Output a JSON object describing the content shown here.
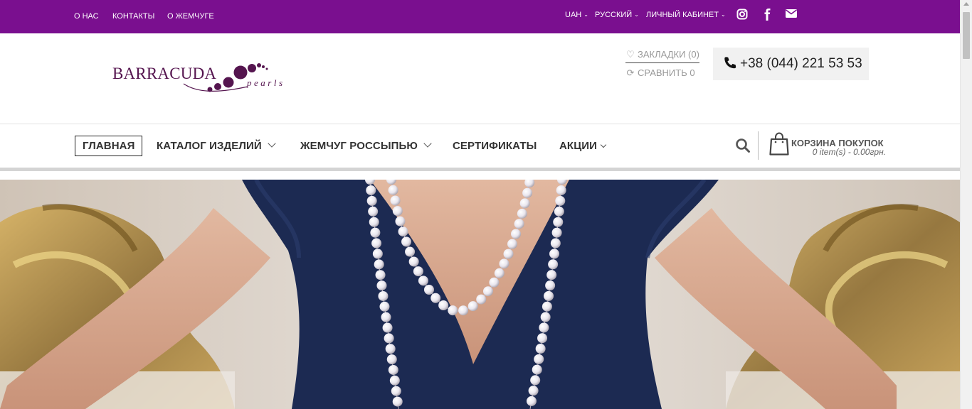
{
  "topbar": {
    "links": [
      "О НАС",
      "КОНТАКТЫ",
      "О ЖЕМЧУГЕ"
    ],
    "currency": "UAH",
    "language": "РУССКИЙ",
    "account": "ЛИЧНЫЙ КАБИНЕТ",
    "socials": [
      "instagram-icon",
      "facebook-icon",
      "envelope-icon"
    ],
    "bg_color": "#7a0f8f"
  },
  "header": {
    "logo_brand": "BARRACUDA",
    "logo_sub": "pearls",
    "wishlist": "ЗАКЛАДКИ (0)",
    "compare": "СРАВНИТЬ 0",
    "phone": "+38 (044) 221 53 53"
  },
  "nav": {
    "items": [
      {
        "label": "ГЛАВНАЯ",
        "active": true
      },
      {
        "label": "КАТАЛОГ ИЗДЕЛИЙ",
        "dropdown": true
      },
      {
        "label": "ЖЕМЧУГ РОССЫПЬЮ",
        "dropdown": true
      },
      {
        "label": "СЕРТИФИКАТЫ"
      },
      {
        "label": "АКЦИИ",
        "dropdown": true
      }
    ]
  },
  "cart": {
    "title": "КОРЗИНА ПОКУПОК",
    "summary": "0 item(s) - 0.00грн."
  },
  "hero": {
    "icon": "hero-slide-image"
  }
}
